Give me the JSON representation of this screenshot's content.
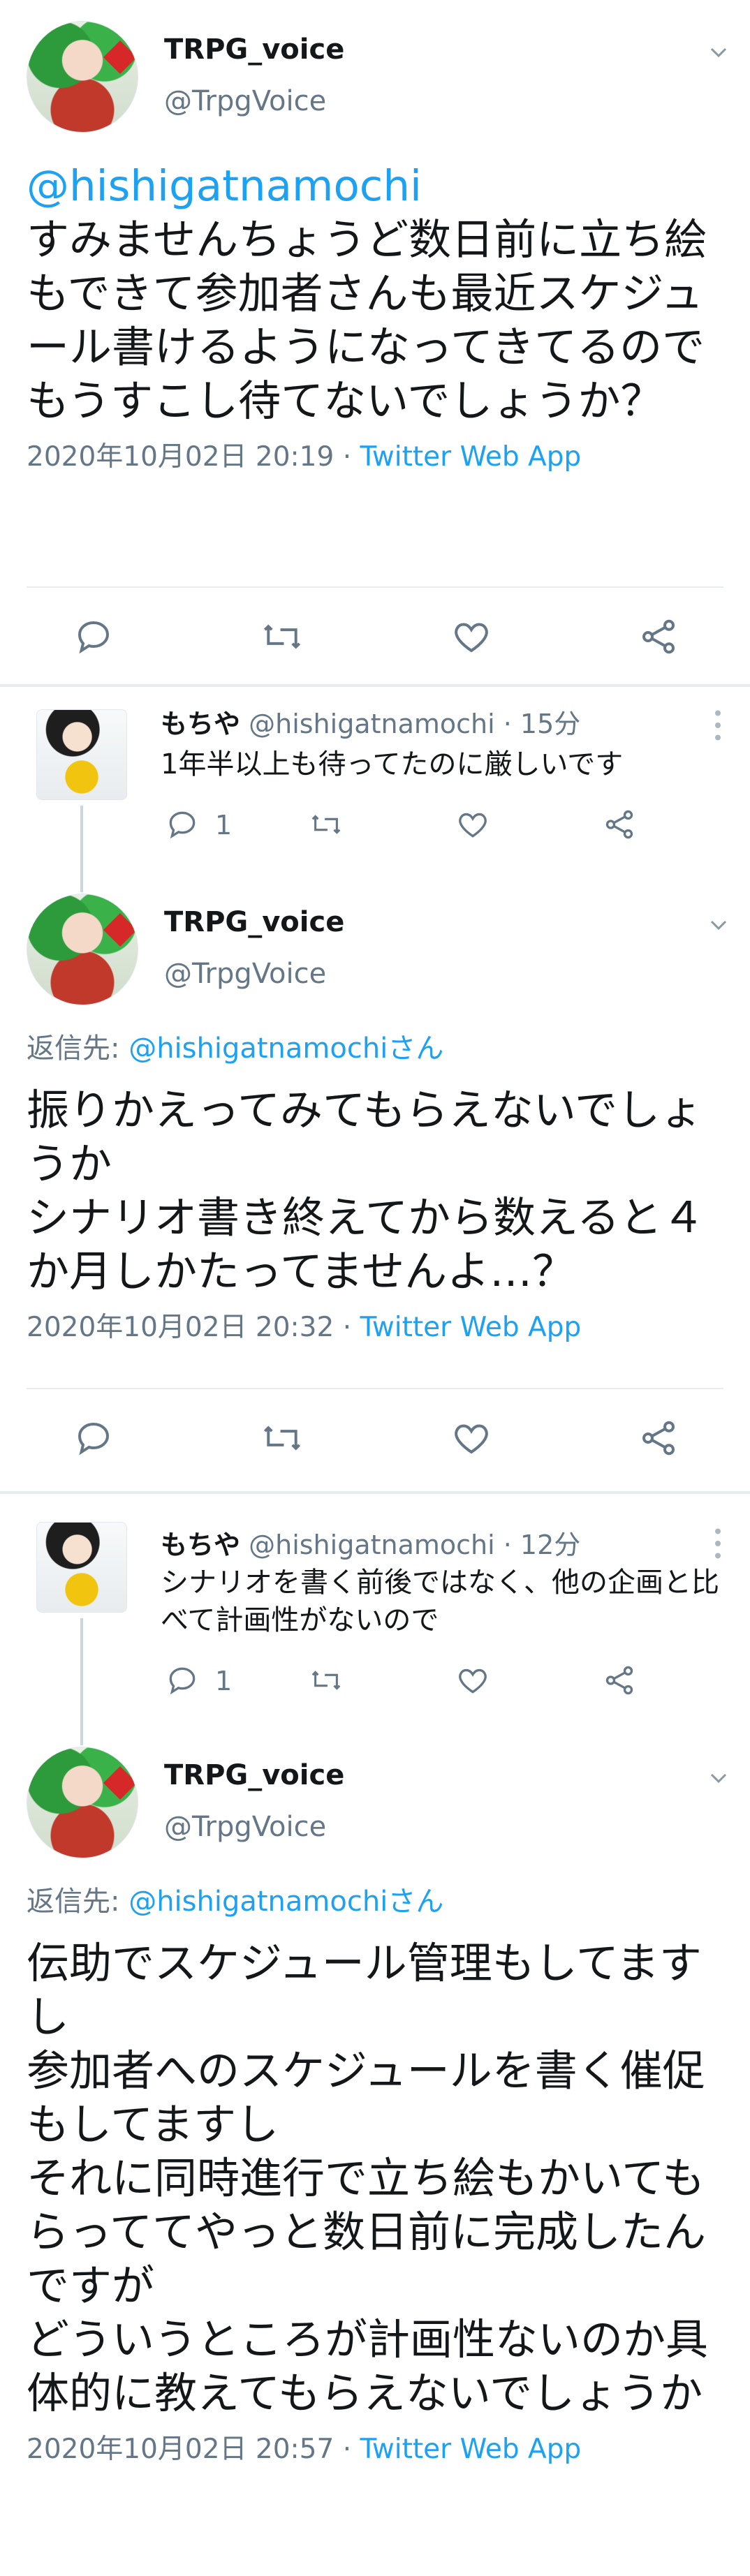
{
  "tweet1": {
    "name": "TRPG_voice",
    "handle": "@TrpgVoice",
    "mention": "@hishigatnamochi",
    "text": "すみませんちょうど数日前に立ち絵もできて参加者さんも最近スケジュール書けるようになってきてるのでもうすこし待てないでしょうか？",
    "date": "2020年10月02日 20:19",
    "separator": " · ",
    "app": "Twitter Web App"
  },
  "reply1": {
    "name": "もちや",
    "handle": "@hishigatnamochi",
    "dot": " · ",
    "time": "15分",
    "text": "1年半以上も待ってたのに厳しいです",
    "reply_count": "1"
  },
  "tweet2": {
    "name": "TRPG_voice",
    "handle": "@TrpgVoice",
    "reply_prefix": "返信先: ",
    "reply_target": "@hishigatnamochiさん",
    "text": "振りかえってみてもらえないでしょうか\nシナリオ書き終えてから数えると４か月しかたってませんよ…？",
    "date": "2020年10月02日 20:32",
    "separator": " · ",
    "app": "Twitter Web App"
  },
  "reply2": {
    "name": "もちや",
    "handle": "@hishigatnamochi",
    "dot": " · ",
    "time": "12分",
    "text": "シナリオを書く前後ではなく、他の企画と比べて計画性がないので",
    "reply_count": "1"
  },
  "tweet3": {
    "name": "TRPG_voice",
    "handle": "@TrpgVoice",
    "reply_prefix": "返信先: ",
    "reply_target": "@hishigatnamochiさん",
    "text": "伝助でスケジュール管理もしてますし\n参加者へのスケジュールを書く催促もしてますし\nそれに同時進行で立ち絵もかいてもらっててやっと数日前に完成したんですが\nどういうところが計画性ないのか具体的に教えてもらえないでしょうか",
    "date": "2020年10月02日 20:57",
    "separator": " · ",
    "app": "Twitter Web App"
  },
  "colors": {
    "accent": "#1da1f2",
    "muted": "#657786",
    "text": "#14171a",
    "divider": "#e6ecf0"
  },
  "icons": {
    "chevron": "chevron-down-icon",
    "reply": "reply-icon",
    "retweet": "retweet-icon",
    "like": "heart-icon",
    "share": "share-icon",
    "more": "more-vertical-icon"
  }
}
